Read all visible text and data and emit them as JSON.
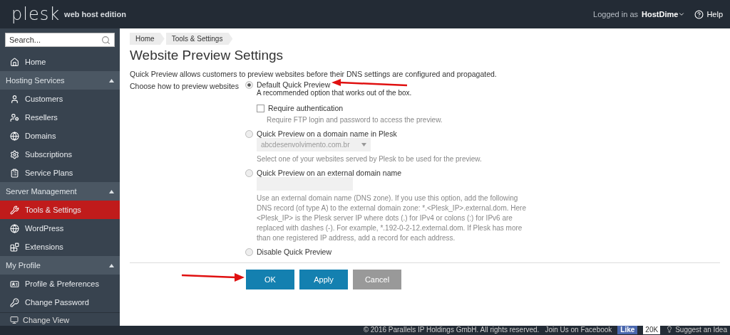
{
  "header": {
    "logo": "plesk",
    "edition": "web host edition",
    "logged_in_label": "Logged in as",
    "user": "HostDime",
    "help": "Help"
  },
  "sidebar": {
    "search": {
      "placeholder": "Search..."
    },
    "home": {
      "label": "Home",
      "selected": false
    },
    "sections": [
      {
        "title": "Hosting Services",
        "expanded": true,
        "items": [
          {
            "label": "Customers",
            "selected": false
          },
          {
            "label": "Resellers",
            "selected": false
          },
          {
            "label": "Domains",
            "selected": false
          },
          {
            "label": "Subscriptions",
            "selected": false
          },
          {
            "label": "Service Plans",
            "selected": false
          }
        ]
      },
      {
        "title": "Server Management",
        "expanded": true,
        "items": [
          {
            "label": "Tools & Settings",
            "selected": true
          },
          {
            "label": "WordPress",
            "selected": false
          },
          {
            "label": "Extensions",
            "selected": false
          }
        ]
      },
      {
        "title": "My Profile",
        "expanded": true,
        "items": [
          {
            "label": "Profile & Preferences",
            "selected": false
          },
          {
            "label": "Change Password",
            "selected": false
          }
        ]
      }
    ],
    "change_view": "Change View"
  },
  "breadcrumb": [
    "Home",
    "Tools & Settings"
  ],
  "title": "Website Preview Settings",
  "description": "Quick Preview allows customers to preview websites before their DNS settings are configured and propagated.",
  "form": {
    "label": "Choose how to preview websites",
    "options": [
      {
        "label": "Default Quick Preview",
        "selected": true,
        "note": "A recommended option that works out of the box.",
        "checkbox": {
          "label": "Require authentication",
          "checked": false,
          "hint": "Require FTP login and password to access the preview."
        }
      },
      {
        "label": "Quick Preview on a domain name in Plesk",
        "selected": false,
        "select": {
          "value": "abcdesenvolvimento.com.br",
          "disabled": true
        },
        "hint": "Select one of your websites served by Plesk to be used for the preview."
      },
      {
        "label": "Quick Preview on an external domain name",
        "selected": false,
        "input": {
          "disabled": true
        },
        "hint": "Use an external domain name (DNS zone). If you use this option, add the following DNS record (of type A) to the external domain zone: *.<Plesk_IP>.external.dom. Here <Plesk_IP> is the Plesk server IP where dots (.) for IPv4 or colons (:) for IPv6 are replaced with dashes (-). For example, *.192-0-2-12.external.dom. If Plesk has more than one registered IP address, add a record for each address."
      },
      {
        "label": "Disable Quick Preview",
        "selected": false
      }
    ]
  },
  "buttons": [
    {
      "label": "OK",
      "kind": "primary"
    },
    {
      "label": "Apply",
      "kind": "primary"
    },
    {
      "label": "Cancel",
      "kind": "secondary"
    }
  ],
  "footer": {
    "copyright": "© 2016 Parallels IP Holdings GmbH. All rights reserved.",
    "facebook": "Join Us on Facebook",
    "like": "Like",
    "like_count": "20K",
    "suggest": "Suggest an Idea"
  }
}
